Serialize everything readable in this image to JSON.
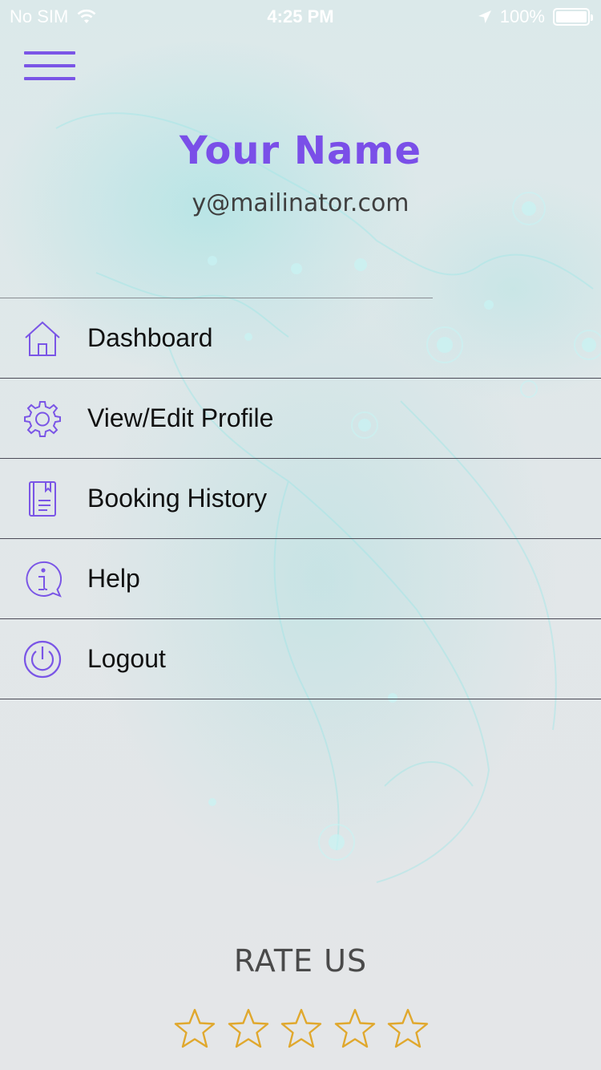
{
  "status_bar": {
    "carrier": "No SIM",
    "time": "4:25 PM",
    "battery": "100%",
    "icons": [
      "wifi-icon",
      "location-arrow-icon",
      "battery-icon"
    ]
  },
  "header": {
    "menu_icon": "hamburger-menu-icon",
    "name": "Your Name",
    "email": "y@mailinator.com"
  },
  "menu": {
    "items": [
      {
        "label": "Dashboard",
        "icon": "home-icon"
      },
      {
        "label": "View/Edit Profile",
        "icon": "gear-icon"
      },
      {
        "label": "Booking History",
        "icon": "book-icon"
      },
      {
        "label": "Help",
        "icon": "info-icon"
      },
      {
        "label": "Logout",
        "icon": "power-icon"
      }
    ]
  },
  "rating": {
    "title": "RATE US",
    "stars_total": 5,
    "stars_filled": 0
  },
  "colors": {
    "accent": "#7a4fe8",
    "star_outline": "#e0a82e",
    "divider": "#4b4b57"
  }
}
